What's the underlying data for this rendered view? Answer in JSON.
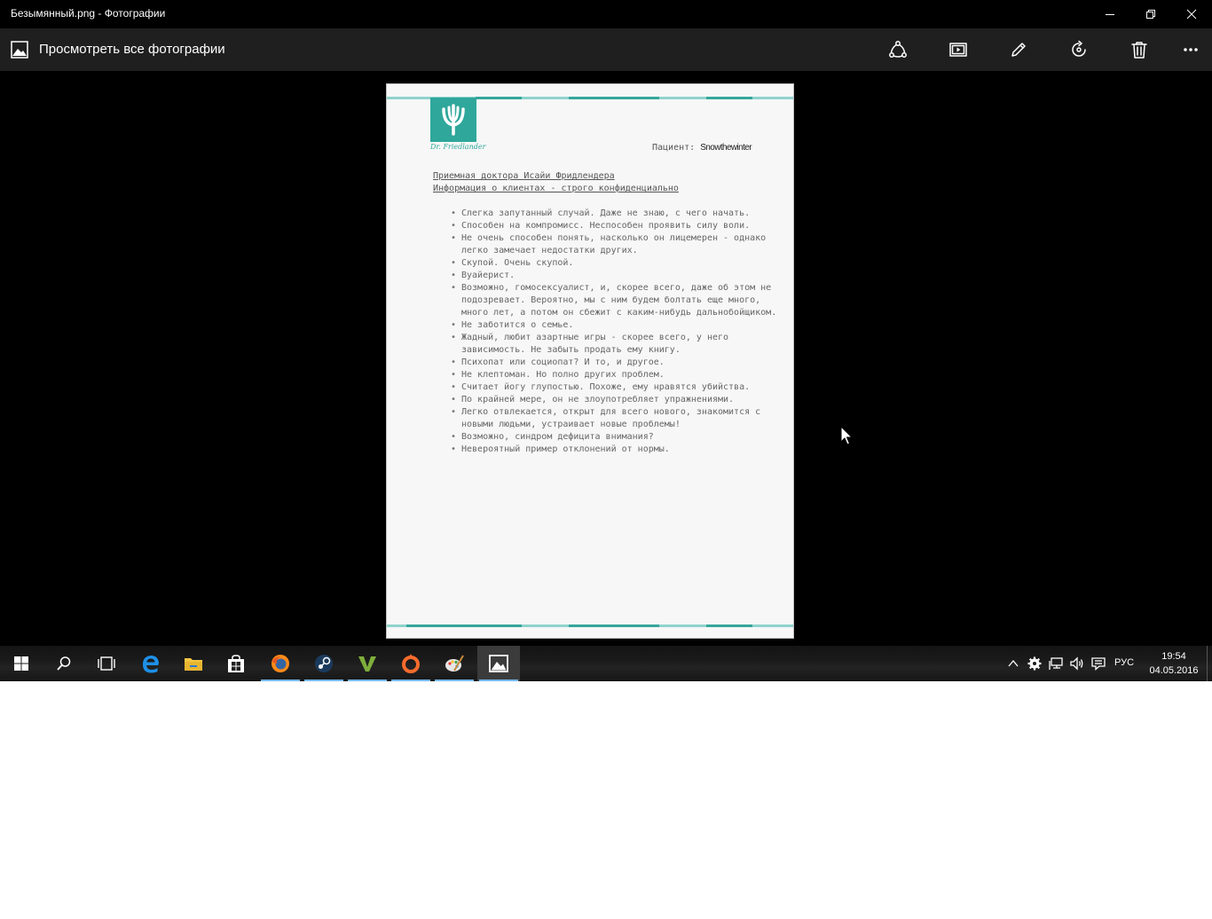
{
  "window": {
    "title": "Безымянный.png - Фотографии"
  },
  "appbar": {
    "view_all": "Просмотреть все фотографии",
    "tools": [
      "share-icon",
      "slideshow-icon",
      "edit-icon",
      "rotate-icon",
      "delete-icon",
      "more-icon"
    ]
  },
  "document": {
    "logo_signature": "Dr. Friedlander",
    "patient_label": "Пациент:",
    "patient_name": "Snowthewinter",
    "heading_line1": "Приемная доктора Исайи Фридлендера",
    "heading_line2": "Информация о клиентах - строго конфиденциально",
    "notes": [
      "Слегка запутанный случай. Даже не знаю, с чего начать.",
      "Способен на компромисс. Неспособен проявить силу воли.",
      "Не очень способен понять, насколько он лицемерен - однако легко замечает недостатки других.",
      "Скупой. Очень скупой.",
      "Вуайерист.",
      "Возможно, гомосексуалист, и, скорее всего, даже об этом не подозревает. Вероятно, мы с ним будем болтать еще много, много лет, а потом он сбежит с каким-нибудь дальнобойщиком.",
      "Не заботится о семье.",
      "Жадный, любит азартные игры - скорее всего, у него зависимость. Не забыть продать ему книгу.",
      "Психопат или социопат? И то, и другое.",
      "Не клептоман. Но полно других проблем.",
      "Считает йогу глупостью. Похоже, ему нравятся убийства.",
      "По крайней мере, он не злоупотребляет упражнениями.",
      "Легко отвлекается, открыт для всего нового, знакомится с новыми людьми, устраивает новые проблемы!",
      "Возможно, синдром дефицита внимания?",
      "Невероятный пример отклонений от нормы."
    ]
  },
  "taskbar": {
    "language": "РУС",
    "time": "19:54",
    "date": "04.05.2016"
  },
  "colors": {
    "accent_teal": "#2fa79b",
    "appbar_bg": "#1f1f1f",
    "taskbar_indicator": "#76b9ed"
  }
}
